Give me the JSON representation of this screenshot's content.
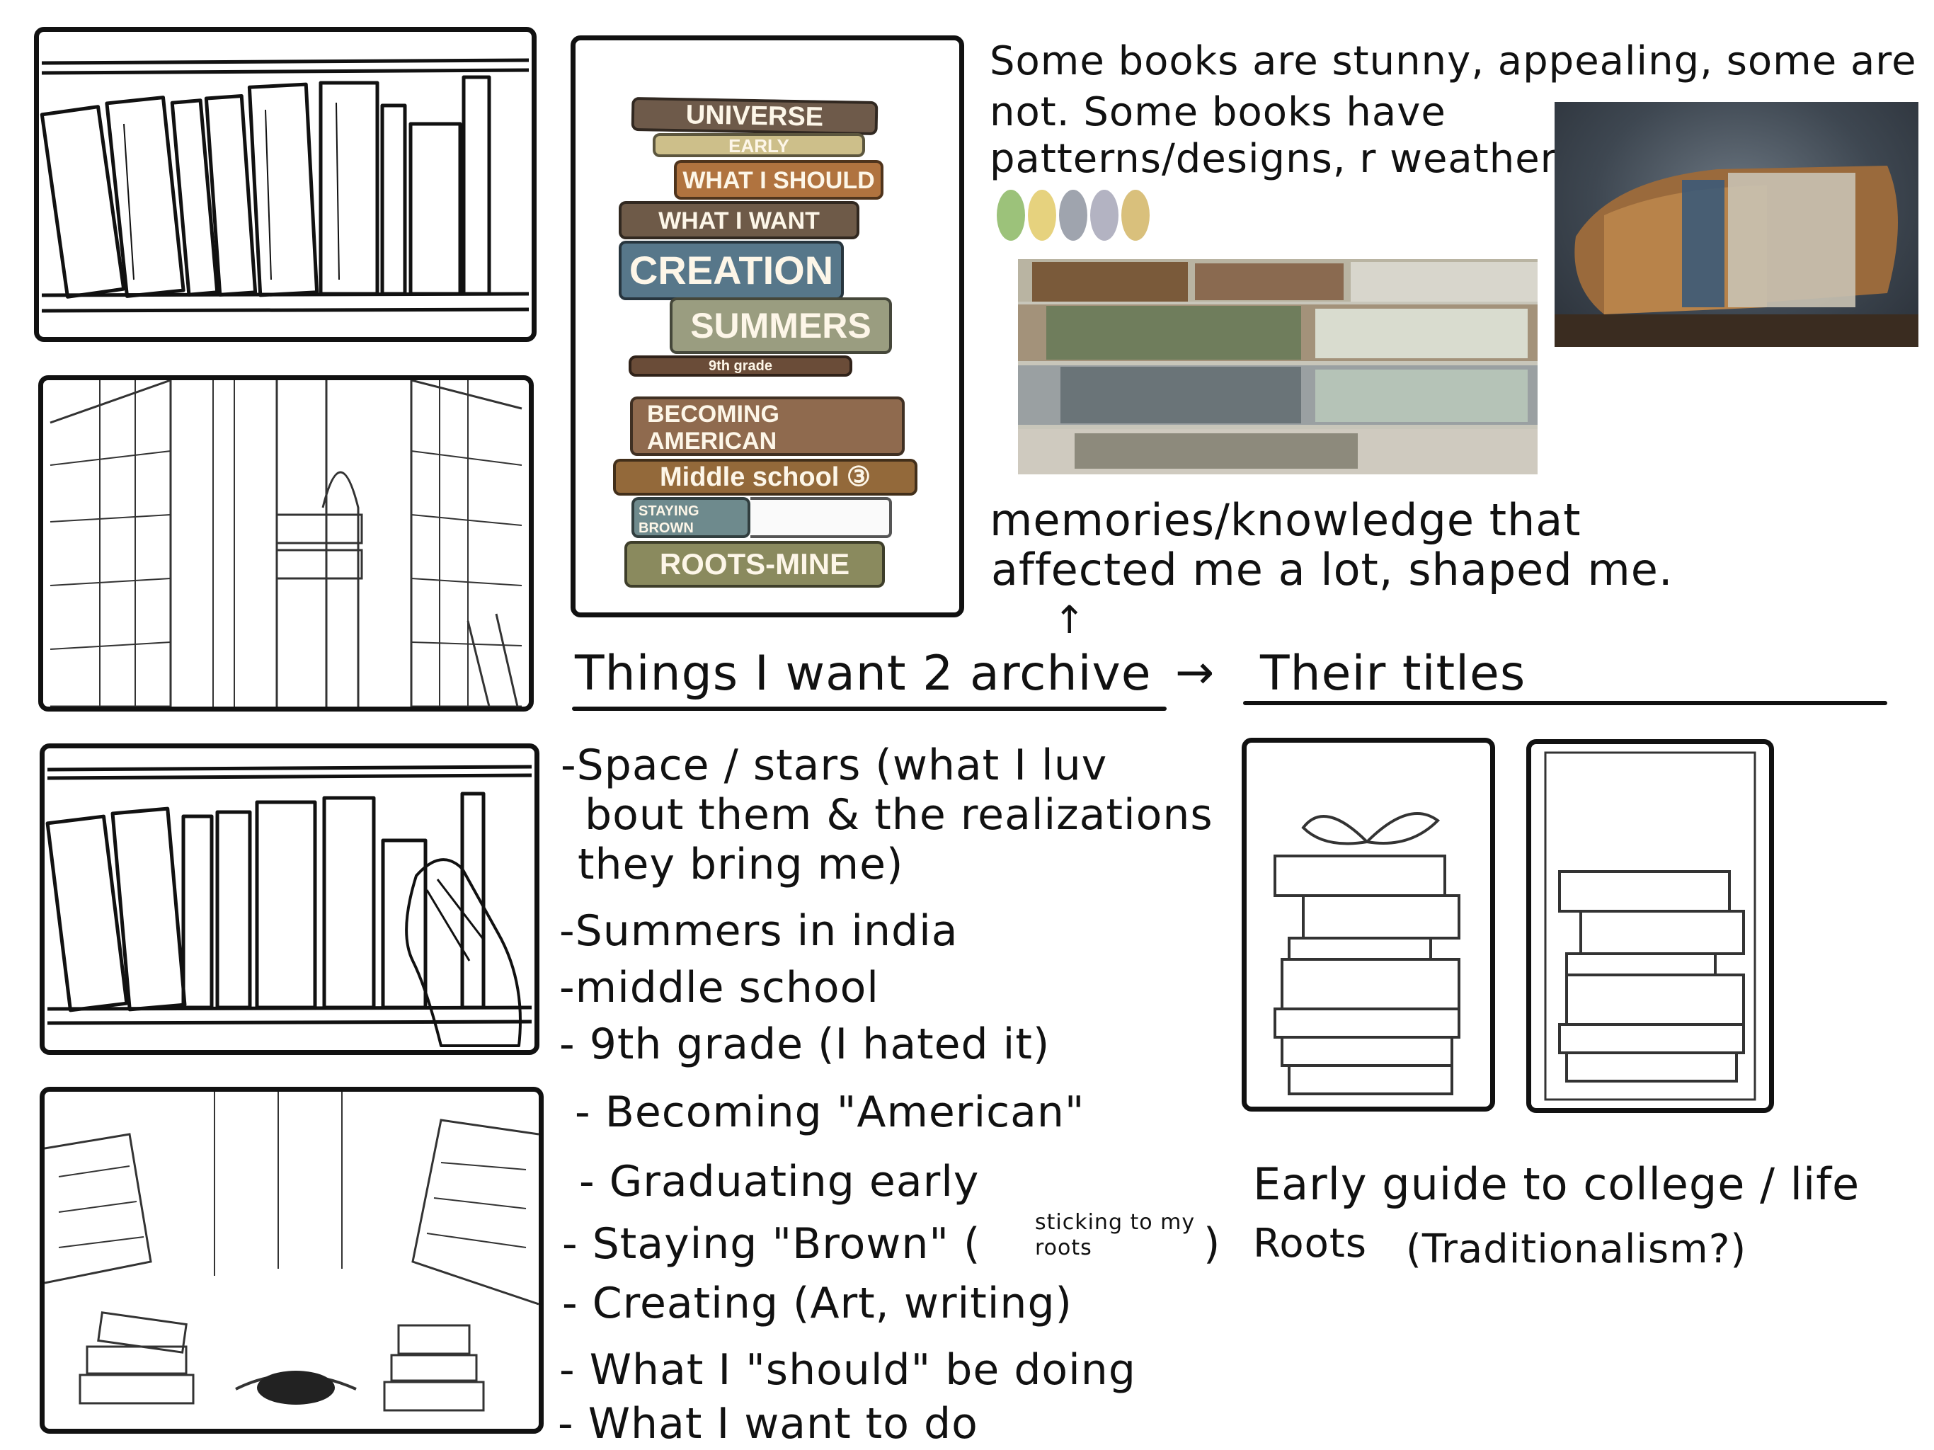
{
  "notes": {
    "appeal_line1": "Some books are stunny, appealing, some are",
    "appeal_line2": "not. Some books have",
    "appeal_line3": "patterns/designs, r weathered.",
    "memories_line1": "memories/knowledge that",
    "memories_line2": "affected me a lot, shaped me.",
    "arrow_up": "↑"
  },
  "headings": {
    "archive": "Things I want 2 archive",
    "arrow": "→",
    "titles": "Their titles"
  },
  "archive_list": [
    "-Space / stars (what I luv",
    "bout them & the realizations",
    "they bring me)",
    "-Summers in india",
    "-middle school",
    "- 9th grade (I hated it)",
    "- Becoming \"American\"",
    "- Graduating early",
    "- Staying \"Brown\" (",
    "- Creating (Art, writing)",
    "- What I \"should\" be doing",
    "- What I want to do"
  ],
  "staying_brown_note": {
    "line1": "sticking to my",
    "line2": "roots",
    "close": ")"
  },
  "book_stack": [
    {
      "label": "UNIVERSE",
      "color": "#6e5a4a"
    },
    {
      "label": "EARLY",
      "color": "#cdbf8a"
    },
    {
      "label": "WHAT I SHOULD",
      "color": "#b0733f"
    },
    {
      "label": "WHAT I WANT",
      "color": "#6e5a48"
    },
    {
      "label": "CREATION",
      "color": "#57778a"
    },
    {
      "label": "SUMMERS",
      "color": "#9a9d80"
    },
    {
      "label": "9th grade",
      "color": "#6a4c38"
    },
    {
      "label": "BECOMING AMERICAN",
      "color": "#8f6a4e"
    },
    {
      "label": "Middle school ③",
      "color": "#93693a"
    },
    {
      "label": "STAYING BROWN",
      "color": "#6e8a8d"
    },
    {
      "label": "ROOTS-MINE",
      "color": "#8a8a5e"
    }
  ],
  "palette": [
    "#9cc27a",
    "#e6d27e",
    "#9fa4ae",
    "#b3b3c2",
    "#d9c07c"
  ],
  "title_captions": {
    "line1": "Early guide to college / life",
    "line2_a": "Roots",
    "line2_b": "(Traditionalism?)"
  }
}
